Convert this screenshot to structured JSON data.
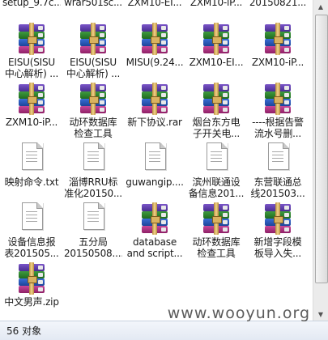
{
  "files": [
    {
      "name": "setup_9.7c...",
      "type": "doc"
    },
    {
      "name": "wrar501sc...",
      "type": "rar"
    },
    {
      "name": "ZXM10-EI...",
      "type": "rar"
    },
    {
      "name": "ZXM10-iP...",
      "type": "rar"
    },
    {
      "name": "20150821...",
      "type": "rar"
    },
    {
      "name": "EISU(SISU\n中心解析) ...",
      "type": "rar"
    },
    {
      "name": "EISU(SISU\n中心解析) ...",
      "type": "rar"
    },
    {
      "name": "MISU(9.24...",
      "type": "rar"
    },
    {
      "name": "ZXM10-EI...",
      "type": "rar"
    },
    {
      "name": "ZXM10-iP...",
      "type": "rar"
    },
    {
      "name": "ZXM10-iP...",
      "type": "rar"
    },
    {
      "name": "动环数据库\n检查工具20...",
      "type": "rar"
    },
    {
      "name": "新下协议.rar",
      "type": "rar"
    },
    {
      "name": "烟台东方电\n子开关电...",
      "type": "rar"
    },
    {
      "name": "----根据告警\n流水号删...",
      "type": "rar"
    },
    {
      "name": "映射命令.txt",
      "type": "doc"
    },
    {
      "name": "淄博RRU标\n准化20150...",
      "type": "doc"
    },
    {
      "name": "guwangip....",
      "type": "doc"
    },
    {
      "name": "滨州联通设\n备信息201...",
      "type": "doc"
    },
    {
      "name": "东营联通总\n线201503...",
      "type": "doc"
    },
    {
      "name": "设备信息报\n表201505...",
      "type": "doc"
    },
    {
      "name": "五分局\n20150508....",
      "type": "doc"
    },
    {
      "name": "database\nand script...",
      "type": "rar"
    },
    {
      "name": "动环数据库\n检查工具20...",
      "type": "rar"
    },
    {
      "name": "新增字段模\n板导入失...",
      "type": "rar"
    },
    {
      "name": "中文男声.zip",
      "type": "rar"
    }
  ],
  "status": {
    "count_text": "56 对象"
  },
  "watermark": "www.wooyun.org"
}
